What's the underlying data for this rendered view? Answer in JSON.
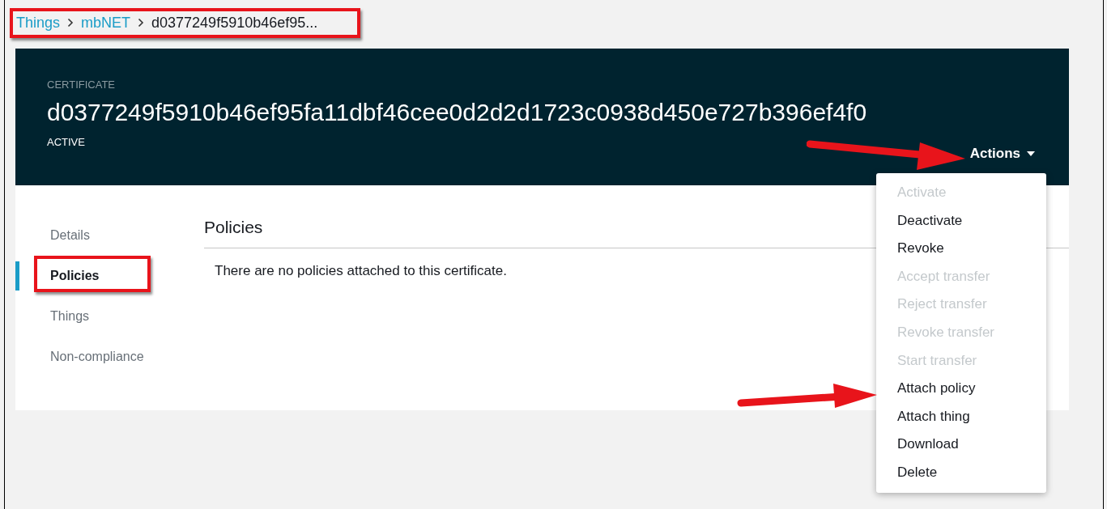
{
  "breadcrumb": [
    {
      "label": "Things",
      "kind": "link"
    },
    {
      "label": "mbNET",
      "kind": "link"
    },
    {
      "label": "d0377249f5910b46ef95...",
      "kind": "current"
    }
  ],
  "header": {
    "label": "CERTIFICATE",
    "title": "d0377249f5910b46ef95fa11dbf46cee0d2d2d1723c0938d450e727b396ef4f0",
    "status": "ACTIVE",
    "actions": "Actions"
  },
  "actions_menu": [
    {
      "label": "Activate",
      "disabled": true
    },
    {
      "label": "Deactivate",
      "disabled": false
    },
    {
      "label": "Revoke",
      "disabled": false
    },
    {
      "label": "Accept transfer",
      "disabled": true
    },
    {
      "label": "Reject transfer",
      "disabled": true
    },
    {
      "label": "Revoke transfer",
      "disabled": true
    },
    {
      "label": "Start transfer",
      "disabled": true
    },
    {
      "label": "Attach policy",
      "disabled": false
    },
    {
      "label": "Attach thing",
      "disabled": false
    },
    {
      "label": "Download",
      "disabled": false
    },
    {
      "label": "Delete",
      "disabled": false
    }
  ],
  "sidebar": {
    "items": [
      {
        "label": "Details",
        "selected": false
      },
      {
        "label": "Policies",
        "selected": true
      },
      {
        "label": "Things",
        "selected": false
      },
      {
        "label": "Non-compliance",
        "selected": false
      }
    ]
  },
  "panel": {
    "title": "Policies",
    "message": "There are no policies attached to this certificate."
  }
}
